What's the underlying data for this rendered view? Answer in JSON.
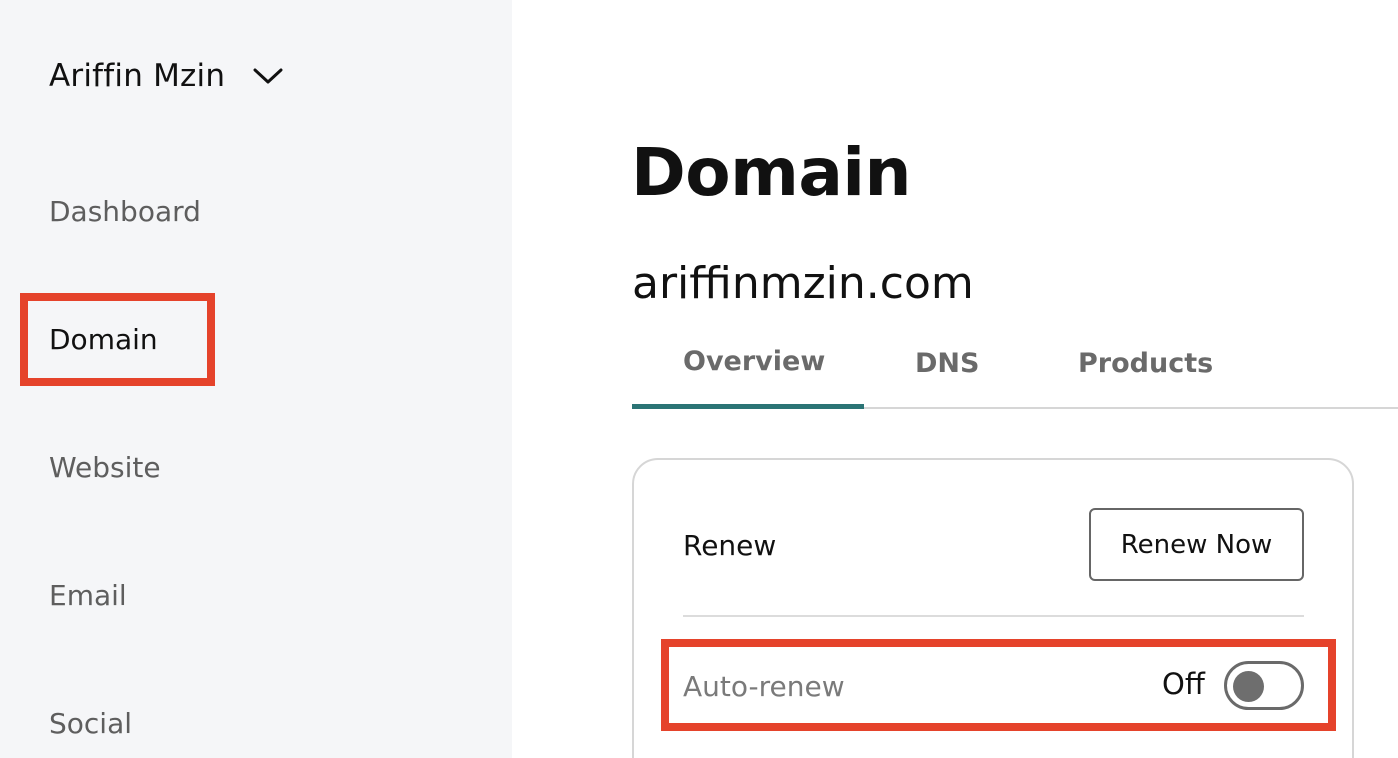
{
  "sidebar": {
    "account": {
      "name": "Ariffin Mzin",
      "icon": "chevron-down-icon"
    },
    "items": [
      {
        "label": "Dashboard",
        "active": false
      },
      {
        "label": "Domain",
        "active": true
      },
      {
        "label": "Website",
        "active": false
      },
      {
        "label": "Email",
        "active": false
      },
      {
        "label": "Social",
        "active": false
      }
    ]
  },
  "main": {
    "title": "Domain",
    "domain_name": "ariffinmzin.com",
    "tabs": [
      {
        "label": "Overview",
        "active": true
      },
      {
        "label": "DNS",
        "active": false
      },
      {
        "label": "Products",
        "active": false
      }
    ],
    "renew_card": {
      "renew_label": "Renew",
      "renew_button": "Renew Now",
      "auto_renew_label": "Auto-renew",
      "auto_renew_status": "Off",
      "auto_renew_enabled": false
    }
  },
  "colors": {
    "sidebar_bg": "#f5f6f8",
    "highlight": "#e5432b",
    "tab_accent": "#2b7475"
  }
}
